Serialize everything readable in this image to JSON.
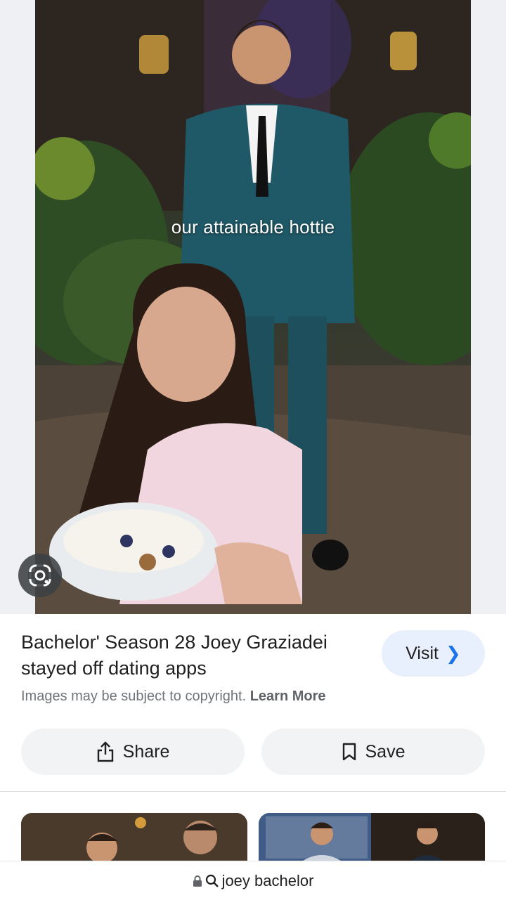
{
  "hero": {
    "caption": "our attainable hottie",
    "image_description_icon": "photo-icon"
  },
  "result": {
    "title": "Bachelor' Season 28 Joey Graziadei stayed off dating apps",
    "visit_label": "Visit",
    "copyright_text": "Images may be subject to copyright.",
    "learn_more_label": "Learn More"
  },
  "actions": {
    "share_label": "Share",
    "save_label": "Save"
  },
  "url_bar": {
    "query": "joey bachelor"
  },
  "colors": {
    "accent": "#1a73e8",
    "visit_bg": "#e8f0fe",
    "button_bg": "#f1f3f4"
  }
}
